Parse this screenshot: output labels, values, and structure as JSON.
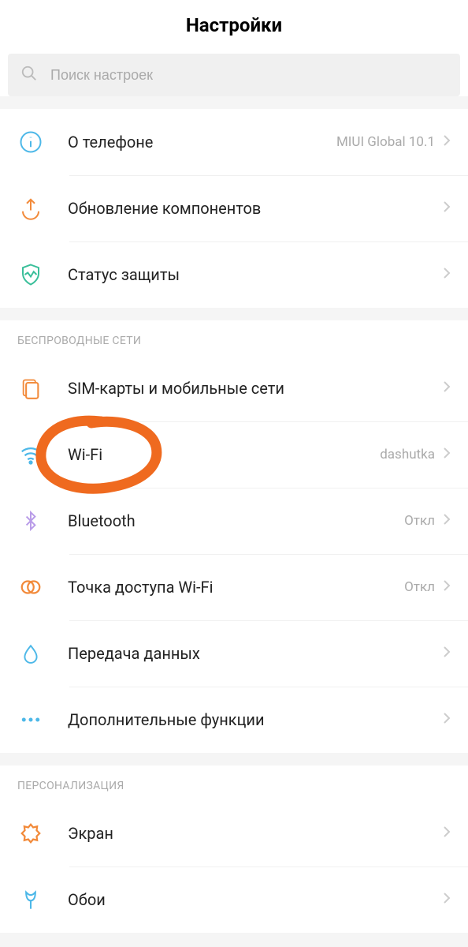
{
  "header": {
    "title": "Настройки"
  },
  "search": {
    "placeholder": "Поиск настроек"
  },
  "group1": {
    "items": [
      {
        "label": "О телефоне",
        "value": "MIUI Global 10.1"
      },
      {
        "label": "Обновление компонентов",
        "value": ""
      },
      {
        "label": "Статус защиты",
        "value": ""
      }
    ]
  },
  "group2": {
    "header": "БЕСПРОВОДНЫЕ СЕТИ",
    "items": [
      {
        "label": "SIM-карты и мобильные сети",
        "value": ""
      },
      {
        "label": "Wi-Fi",
        "value": "dashutka"
      },
      {
        "label": "Bluetooth",
        "value": "Откл"
      },
      {
        "label": "Точка доступа Wi-Fi",
        "value": "Откл"
      },
      {
        "label": "Передача данных",
        "value": ""
      },
      {
        "label": "Дополнительные функции",
        "value": ""
      }
    ]
  },
  "group3": {
    "header": "ПЕРСОНАЛИЗАЦИЯ",
    "items": [
      {
        "label": "Экран",
        "value": ""
      },
      {
        "label": "Обои",
        "value": ""
      }
    ]
  }
}
